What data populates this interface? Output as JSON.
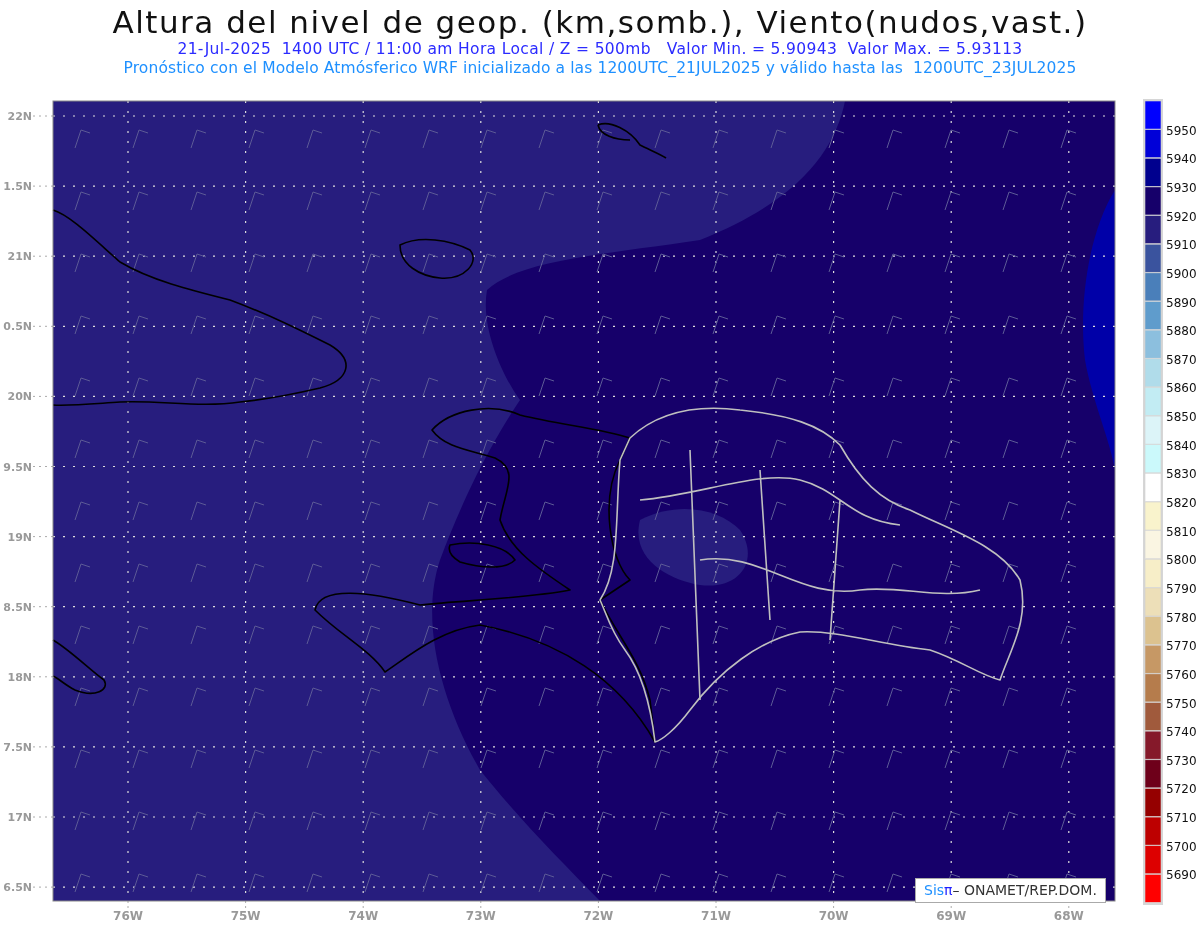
{
  "title": "Altura del nivel de geop. (km,somb.), Viento(nudos,vast.)",
  "subtitle": "21-Jul-2025  1400 UTC / 11:00 am Hora Local / Z = 500mb   Valor Min. = 5.90943  Valor Max. = 5.93113",
  "forecast_line": "Pronóstico con el Modelo Atmósferico WRF inicializado a las 1200UTC_21JUL2025 y válido hasta las  1200UTC_23JUL2025",
  "y_axis": [
    "22N",
    "1.5N",
    "21N",
    "0.5N",
    "20N",
    "9.5N",
    "19N",
    "8.5N",
    "18N",
    "7.5N",
    "17N",
    "6.5N"
  ],
  "x_axis": [
    "76W",
    "75W",
    "74W",
    "73W",
    "72W",
    "71W",
    "70W",
    "69W",
    "68W"
  ],
  "colorbar": {
    "segments": [
      {
        "color": "#0000fe"
      },
      {
        "color": "#0000d8"
      },
      {
        "color": "#00008e"
      },
      {
        "color": "#16006a"
      },
      {
        "color": "#271d7e"
      },
      {
        "color": "#3a539e"
      },
      {
        "color": "#4a7fba"
      },
      {
        "color": "#5f9ccc"
      },
      {
        "color": "#8cbfde"
      },
      {
        "color": "#b0dcea"
      },
      {
        "color": "#c2ecf3"
      },
      {
        "color": "#dcf4f8"
      },
      {
        "color": "#cbf9fb"
      },
      {
        "color": "#ffffff"
      },
      {
        "color": "#f9f3cc"
      },
      {
        "color": "#faf5e2"
      },
      {
        "color": "#f7eec8"
      },
      {
        "color": "#eddfb8"
      },
      {
        "color": "#dcc28f"
      },
      {
        "color": "#c69865"
      },
      {
        "color": "#b57c4c"
      },
      {
        "color": "#a05a3c"
      },
      {
        "color": "#85192a"
      },
      {
        "color": "#6e001a"
      },
      {
        "color": "#950000"
      },
      {
        "color": "#bd0000"
      },
      {
        "color": "#dd0000"
      },
      {
        "color": "#ff0000"
      }
    ],
    "labels": [
      "5950",
      "5940",
      "5930",
      "5920",
      "5910",
      "5900",
      "5890",
      "5880",
      "5870",
      "5860",
      "5850",
      "5840",
      "5830",
      "5820",
      "5810",
      "5800",
      "5790",
      "5780",
      "5770",
      "5760",
      "5750",
      "5740",
      "5730",
      "5720",
      "5710",
      "5700",
      "5690"
    ]
  },
  "credit": {
    "brand": "Sis",
    "symbol": "π",
    "text": "– ONAMET/REP.DOM."
  }
}
